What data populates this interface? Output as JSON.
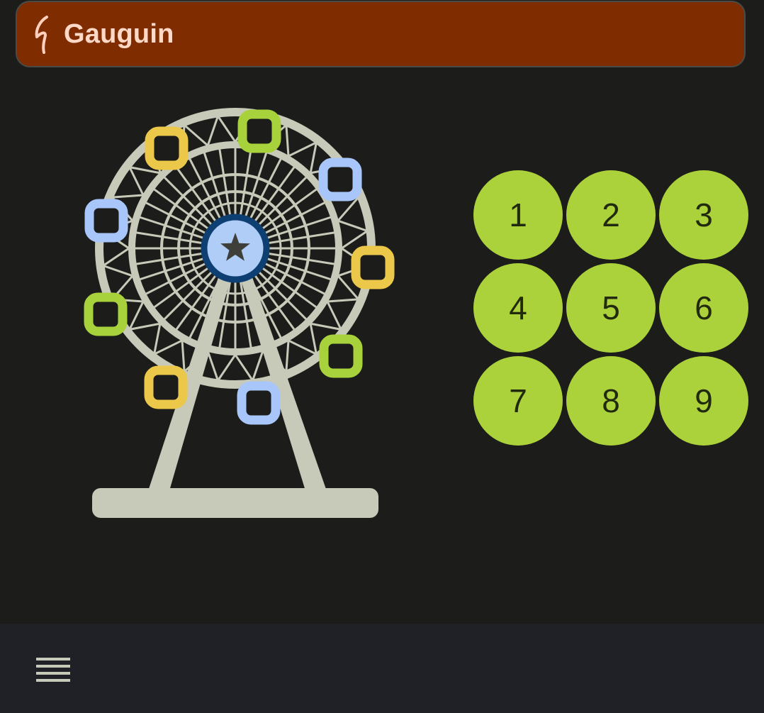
{
  "app": {
    "title": "Gauguin",
    "logo_icon": "squiggle-logo-icon"
  },
  "illustration": {
    "name": "ferris-wheel-illustration",
    "colors": {
      "frame": "#c7c9b9",
      "hub": "#0e3f73",
      "hub_fill": "#b0cdf8",
      "star": "#3f3f3a",
      "yellow_cabin": "#ecc84a",
      "green_cabin": "#a8d23b",
      "blue_cabin": "#a9c6fb"
    }
  },
  "keypad": {
    "keys": [
      "1",
      "2",
      "3",
      "4",
      "5",
      "6",
      "7",
      "8",
      "9"
    ]
  },
  "bottom_bar": {
    "menu_icon": "hamburger-menu-icon"
  },
  "colors": {
    "background": "#1c1d1a",
    "title_bar": "#7e2c00",
    "title_text": "#ffd9c8",
    "key_fill": "#acd23b",
    "key_text": "#222a0d",
    "bottom_bar": "#202126",
    "menu_icon": "#c7c9b9"
  }
}
